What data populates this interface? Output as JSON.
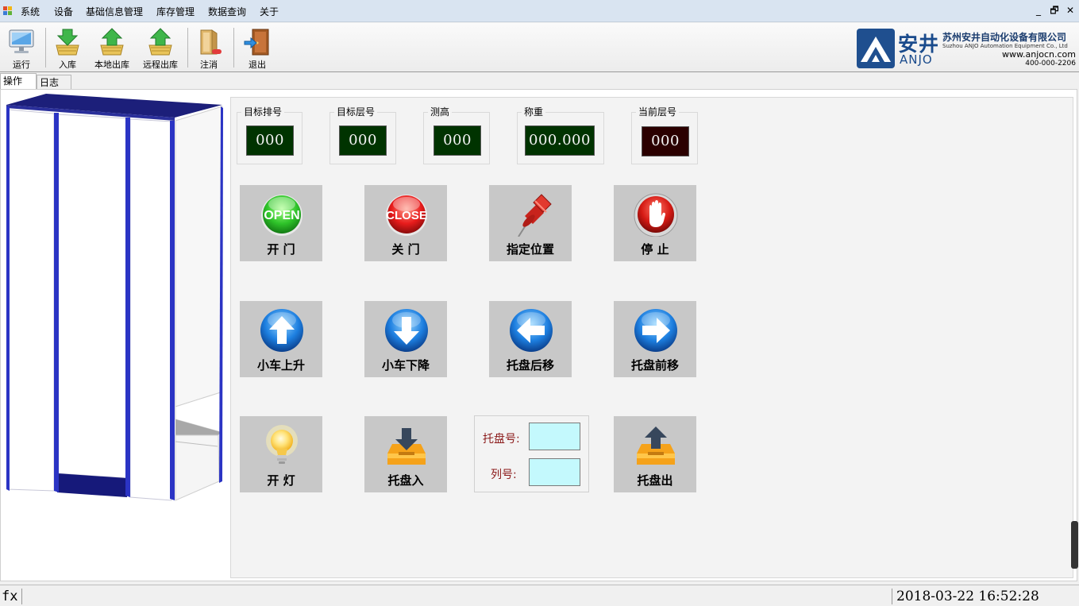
{
  "menu": {
    "items": [
      "系统",
      "设备",
      "基础信息管理",
      "库存管理",
      "数据查询",
      "关于"
    ],
    "window_controls": [
      "_",
      "🗗",
      "✕"
    ]
  },
  "toolbar": {
    "buttons": [
      {
        "label": "运行",
        "icon": "monitor-icon"
      },
      {
        "label": "入库",
        "icon": "inbound-icon"
      },
      {
        "label": "本地出库",
        "icon": "local-outbound-icon"
      },
      {
        "label": "远程出库",
        "icon": "remote-outbound-icon"
      },
      {
        "label": "注消",
        "icon": "logoff-icon"
      },
      {
        "label": "退出",
        "icon": "exit-door-icon"
      }
    ]
  },
  "logo": {
    "brand_cn": "安井",
    "brand_en": "ANJO",
    "company": "苏州安井自动化设备有限公司",
    "company_en": "Suzhou ANJO Automation Equipment Co., Ltd",
    "website": "www.anjocn.com",
    "phone": "400-000-2206"
  },
  "tabs": [
    "操作",
    "日志"
  ],
  "active_tab": "操作",
  "readouts": [
    {
      "title": "目标排号",
      "value": "000",
      "color": "#003300"
    },
    {
      "title": "目标层号",
      "value": "000",
      "color": "#003300"
    },
    {
      "title": "测高",
      "value": "000",
      "color": "#003300"
    },
    {
      "title": "称重",
      "value": "000.000",
      "color": "#003300"
    },
    {
      "title": "当前层号",
      "value": "000",
      "color": "#2b0000"
    }
  ],
  "buttons": {
    "open_door": {
      "label": "开 门",
      "icon": "open-icon",
      "icon_text": "OPEN"
    },
    "close_door": {
      "label": "关 门",
      "icon": "close-icon",
      "icon_text": "CLOSE"
    },
    "set_position": {
      "label": "指定位置",
      "icon": "pushpin-icon"
    },
    "stop": {
      "label": "停 止",
      "icon": "stop-hand-icon"
    },
    "cart_up": {
      "label": "小车上升",
      "icon": "arrow-up-icon"
    },
    "cart_down": {
      "label": "小车下降",
      "icon": "arrow-down-icon"
    },
    "tray_back": {
      "label": "托盘后移",
      "icon": "arrow-left-icon"
    },
    "tray_forward": {
      "label": "托盘前移",
      "icon": "arrow-right-icon"
    },
    "light_on": {
      "label": "开 灯",
      "icon": "light-bulb-icon"
    },
    "tray_in": {
      "label": "托盘入",
      "icon": "tray-in-icon"
    },
    "tray_out": {
      "label": "托盘出",
      "icon": "tray-out-icon"
    }
  },
  "pallet_form": {
    "pallet_label": "托盘号:",
    "pallet_value": "",
    "column_label": "列号:",
    "column_value": ""
  },
  "statusbar": {
    "fx": "fx",
    "datetime": "2018-03-22 16:52:28"
  }
}
